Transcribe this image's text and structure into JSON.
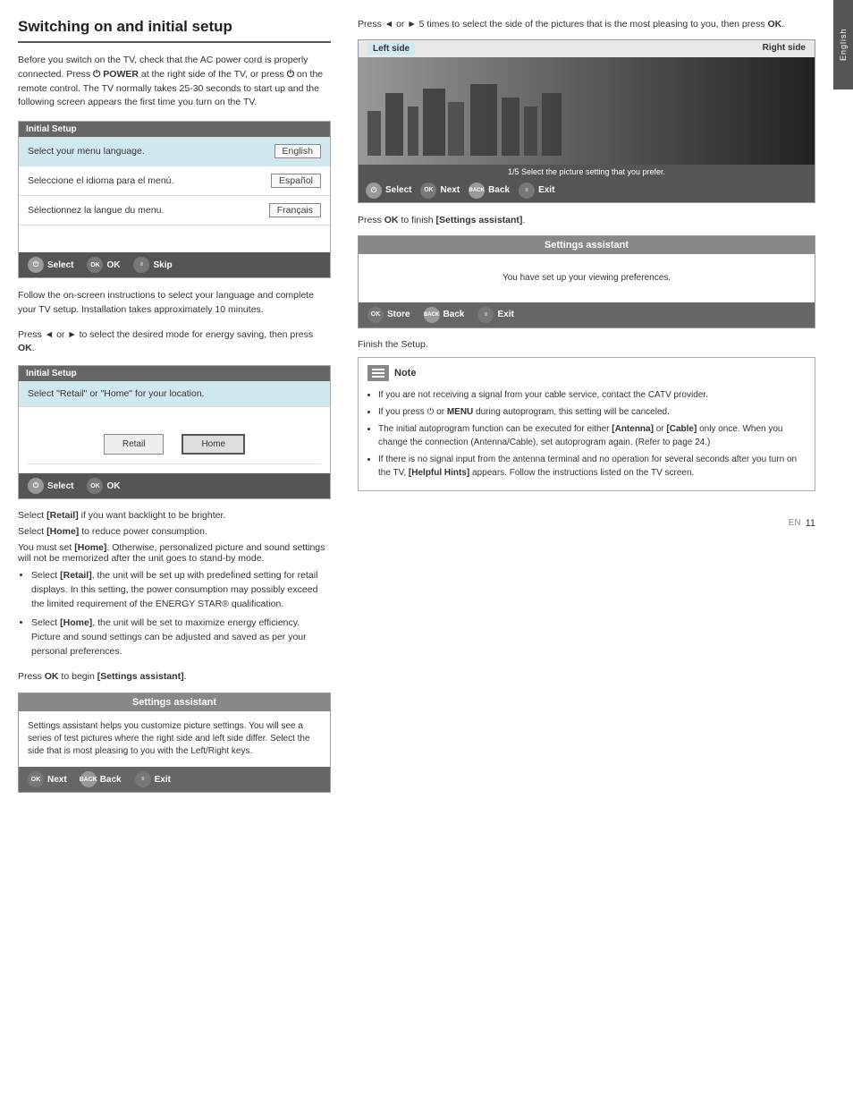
{
  "page": {
    "title": "Switching on and initial setup",
    "side_tab": "English",
    "page_number": "11",
    "en_label": "EN"
  },
  "left_column": {
    "intro_text": "Before you switch on the TV, check that the AC power cord is properly connected. Press",
    "intro_text2": "POWER at the right side of the TV, or press",
    "intro_text3": "on the remote control. The TV normally takes 25-30 seconds to start up and the following screen appears the first time you turn on the TV.",
    "initial_setup_label": "Initial Setup",
    "languages": [
      {
        "text": "Select your menu language.",
        "selected_lang": "English",
        "highlighted": true
      },
      {
        "text": "Seleccione el idioma para el menú.",
        "selected_lang": "Español",
        "highlighted": false
      },
      {
        "text": "Sélectionnez la langue du menu.",
        "selected_lang": "Français",
        "highlighted": false
      }
    ],
    "footer_buttons_1": [
      {
        "label": "Select",
        "icon": "power"
      },
      {
        "label": "OK",
        "icon": "ok"
      },
      {
        "label": "Skip",
        "icon": "menu"
      }
    ],
    "follow_text": "Follow the on-screen instructions to select your language and complete your TV setup. Installation takes approximately 10 minutes.",
    "press_energy_text": "Press ◄ or ► to select the desired mode for energy saving, then press OK.",
    "initial_setup_label_2": "Initial Setup",
    "retail_text": "Select \"Retail\" or \"Home\" for your location.",
    "modes": [
      "Retail",
      "Home"
    ],
    "footer_buttons_2": [
      {
        "label": "Select",
        "icon": "power"
      },
      {
        "label": "OK",
        "icon": "ok"
      }
    ],
    "select_retail_text": "Select [Retail] if you want backlight to be brighter.",
    "select_home_text": "Select [Home] to reduce power consumption.",
    "must_set_text": "You must set [Home]. Otherwise, personalized picture and sound settings will not be memorized after the unit goes to stand-by mode.",
    "bullet_items": [
      "Select [Retail], the unit will be set up with predefined setting for retail displays. In this setting, the power consumption may possibly exceed the limited requirement of the ENERGY STAR® qualification.",
      "Select [Home], the unit will be set to maximize energy efficiency. Picture and sound settings can be adjusted and saved as per your personal preferences."
    ],
    "press_settings_begin": "Press OK to begin [Settings assistant].",
    "settings_box": {
      "title": "Settings assistant",
      "body": "Settings assistant helps you customize picture settings. You will see a series of test pictures where the right side and left side differ. Select the side that is most pleasing to you with the Left/Right keys.",
      "buttons": [
        {
          "label": "Next",
          "icon": "ok"
        },
        {
          "label": "Back",
          "icon": "back"
        },
        {
          "label": "Exit",
          "icon": "menu"
        }
      ]
    }
  },
  "right_column": {
    "press_pictures_text": "Press ◄ or ► 5 times to select the side of the pictures that is the most pleasing to you, then press OK.",
    "picture_left_label": "Left side",
    "picture_right_label": "Right side",
    "picture_caption": "1/5 Select the picture setting that you prefer.",
    "picture_buttons": [
      {
        "label": "Select",
        "icon": "power"
      },
      {
        "label": "Next",
        "icon": "ok"
      },
      {
        "label": "Back",
        "icon": "back"
      },
      {
        "label": "Exit",
        "icon": "menu"
      }
    ],
    "press_ok_finish": "Press OK to finish [Settings assistant].",
    "settings_finish_box": {
      "title": "Settings assistant",
      "body": "You have set up your viewing preferences.",
      "buttons": [
        {
          "label": "Store",
          "icon": "ok"
        },
        {
          "label": "Back",
          "icon": "back"
        },
        {
          "label": "Exit",
          "icon": "menu"
        }
      ]
    },
    "finish_text": "Finish the Setup.",
    "note_title": "Note",
    "note_items": [
      "If you are not receiving a signal from your cable service, contact the CATV provider.",
      "If you press ⏻ or MENU during autoprogram, this setting will be canceled.",
      "The initial autoprogram function can be executed for either [Antenna] or [Cable] only once. When you change the connection (Antenna/Cable), set autoprogram again. (Refer to page 24.)",
      "If there is no signal input from the antenna terminal and no operation for several seconds after you turn on the TV, [Helpful Hints] appears. Follow the instructions listed on the TV screen."
    ]
  }
}
